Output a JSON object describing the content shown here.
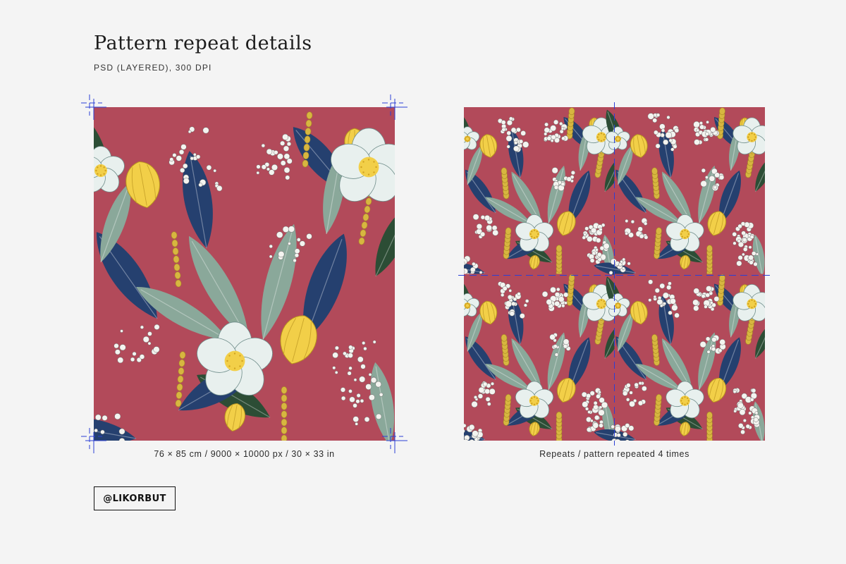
{
  "header": {
    "title": "Pattern repeat details",
    "subtitle": "PSD (LAYERED), 300 DPI"
  },
  "panels": {
    "single": {
      "caption": "76 × 85 cm / 9000 × 10000 px / 30 × 33 in"
    },
    "repeat": {
      "caption": "Repeats / pattern repeated 4 times",
      "tiles": 4
    }
  },
  "brand": {
    "handle": "@LIKORBUT"
  },
  "colors": {
    "background": "#f4f4f4",
    "pattern_base": "#b24a5a",
    "leaf_navy": "#25406f",
    "leaf_sage": "#8aa89a",
    "leaf_dark": "#2c4d35",
    "flower_white": "#e8f0ee",
    "flower_yellow": "#f2cf48",
    "guide_blue": "#2b3fd6"
  }
}
